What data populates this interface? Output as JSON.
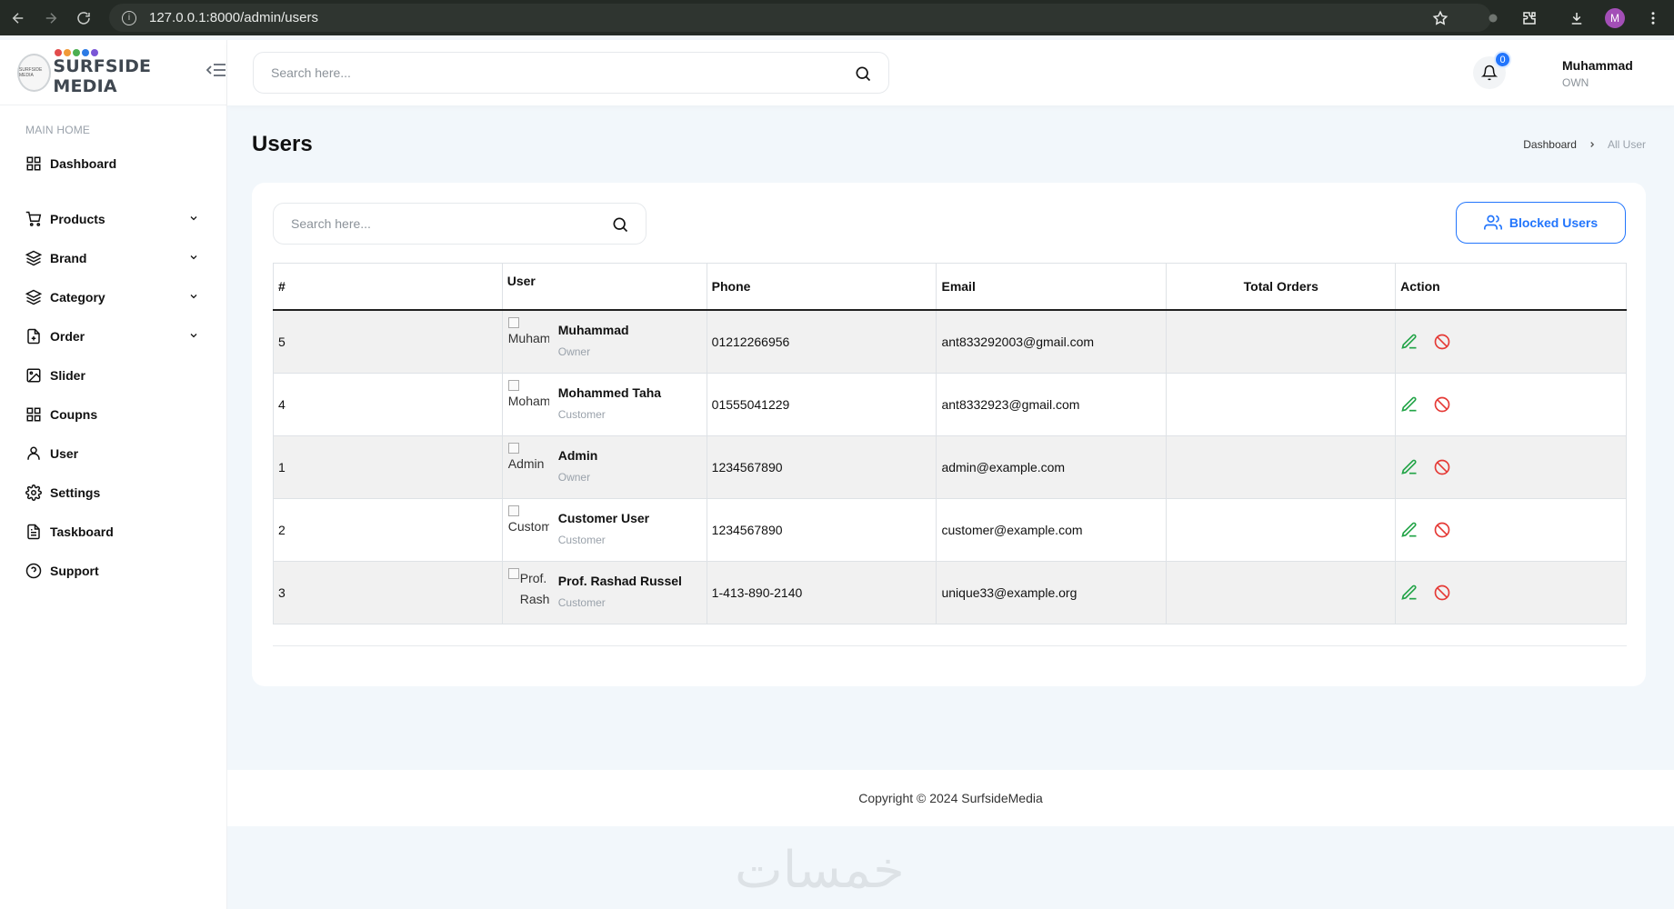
{
  "browser": {
    "url": "127.0.0.1:8000/admin/users",
    "profile_initial": "M"
  },
  "sidebar": {
    "logo": {
      "small_text": "SURFSIDE MEDIA",
      "brand": "SURFSIDE MEDIA",
      "dot_colors": [
        "#e24c4c",
        "#f19a38",
        "#4caf50",
        "#2c7be5",
        "#7a56d6"
      ]
    },
    "section_title": "MAIN HOME",
    "items": [
      {
        "label": "Dashboard",
        "icon": "grid-icon",
        "has_submenu": false
      },
      {
        "label": "Products",
        "icon": "cart-icon",
        "has_submenu": true
      },
      {
        "label": "Brand",
        "icon": "layers-icon",
        "has_submenu": true
      },
      {
        "label": "Category",
        "icon": "layers-icon",
        "has_submenu": true
      },
      {
        "label": "Order",
        "icon": "file-plus-icon",
        "has_submenu": true
      },
      {
        "label": "Slider",
        "icon": "image-icon",
        "has_submenu": false
      },
      {
        "label": "Coupns",
        "icon": "grid-icon",
        "has_submenu": false
      },
      {
        "label": "User",
        "icon": "user-icon",
        "has_submenu": false
      },
      {
        "label": "Settings",
        "icon": "settings-icon",
        "has_submenu": false
      },
      {
        "label": "Taskboard",
        "icon": "file-text-icon",
        "has_submenu": false
      },
      {
        "label": "Support",
        "icon": "help-circle-icon",
        "has_submenu": false
      }
    ]
  },
  "header": {
    "search_placeholder": "Search here...",
    "notification_count": "0",
    "user_name": "Muhammad",
    "user_role": "OWN"
  },
  "page": {
    "title": "Users",
    "breadcrumb": {
      "home": "Dashboard",
      "current": "All User"
    }
  },
  "panel": {
    "search_placeholder": "Search here...",
    "blocked_button_label": "Blocked Users",
    "columns": [
      "#",
      "User",
      "Phone",
      "Email",
      "Total Orders",
      "Action"
    ],
    "rows": [
      {
        "id": "5",
        "avatar_alt": "Muhammad",
        "name": "Muhammad",
        "role": "Owner",
        "phone": "01212266956",
        "email": "ant833292003@gmail.com",
        "total_orders": ""
      },
      {
        "id": "4",
        "avatar_alt": "Mohammed Taha",
        "name": "Mohammed Taha",
        "role": "Customer",
        "phone": "01555041229",
        "email": "ant8332923@gmail.com",
        "total_orders": ""
      },
      {
        "id": "1",
        "avatar_alt": "Admin",
        "name": "Admin",
        "role": "Owner",
        "phone": "1234567890",
        "email": "admin@example.com",
        "total_orders": ""
      },
      {
        "id": "2",
        "avatar_alt": "Customer User",
        "name": "Customer User",
        "role": "Customer",
        "phone": "1234567890",
        "email": "customer@example.com",
        "total_orders": ""
      },
      {
        "id": "3",
        "avatar_alt": "Prof. Rashad Russel",
        "name": "Prof. Rashad Russel",
        "role": "Customer",
        "phone": "1-413-890-2140",
        "email": "unique33@example.org",
        "total_orders": ""
      }
    ]
  },
  "footer": {
    "copyright": "Copyright © 2024 SurfsideMedia"
  },
  "watermark": "خمسات",
  "colors": {
    "accent": "#2275fc",
    "edit": "#22a447",
    "block": "#e53935"
  }
}
